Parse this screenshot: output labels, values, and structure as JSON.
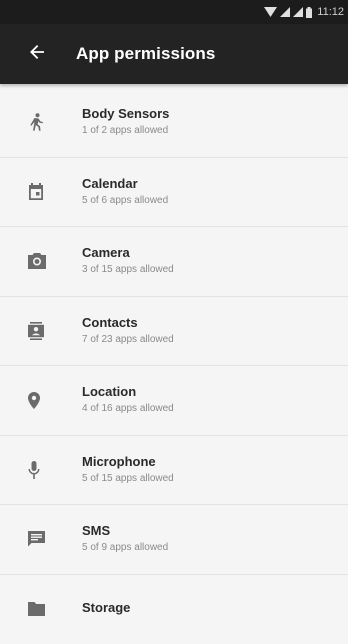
{
  "status_bar": {
    "time": "11:12",
    "icons": [
      "wifi-icon",
      "signal-icon",
      "signal-icon",
      "battery-icon"
    ]
  },
  "app_bar": {
    "back_icon": "arrow-back-icon",
    "title": "App permissions"
  },
  "colors": {
    "status_bar": "#1c1c1c",
    "app_bar": "#232323",
    "background": "#f5f5f5",
    "icon": "#6b6b6b"
  },
  "permissions": [
    {
      "icon": "body-sensors-icon",
      "title": "Body Sensors",
      "subtitle": "1 of 2 apps allowed"
    },
    {
      "icon": "calendar-icon",
      "title": "Calendar",
      "subtitle": "5 of 6 apps allowed"
    },
    {
      "icon": "camera-icon",
      "title": "Camera",
      "subtitle": "3 of 15 apps allowed"
    },
    {
      "icon": "contacts-icon",
      "title": "Contacts",
      "subtitle": "7 of 23 apps allowed"
    },
    {
      "icon": "location-icon",
      "title": "Location",
      "subtitle": "4 of 16 apps allowed"
    },
    {
      "icon": "microphone-icon",
      "title": "Microphone",
      "subtitle": "5 of 15 apps allowed"
    },
    {
      "icon": "sms-icon",
      "title": "SMS",
      "subtitle": "5 of 9 apps allowed"
    },
    {
      "icon": "storage-icon",
      "title": "Storage",
      "subtitle": ""
    }
  ]
}
